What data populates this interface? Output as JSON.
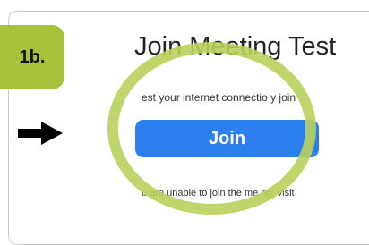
{
  "step": {
    "label": "1b."
  },
  "page": {
    "title": "Join Meeting Test",
    "subtitle": "est your internet connectio    y join",
    "join_label": "Join",
    "note": "u are unable to join the me    ng, visit"
  },
  "colors": {
    "badge": "#a8c13a",
    "highlight": "#b9d25c",
    "button": "#2d7ff0",
    "arrow": "#000000"
  },
  "icons": {
    "arrow": "arrow-right-icon"
  }
}
